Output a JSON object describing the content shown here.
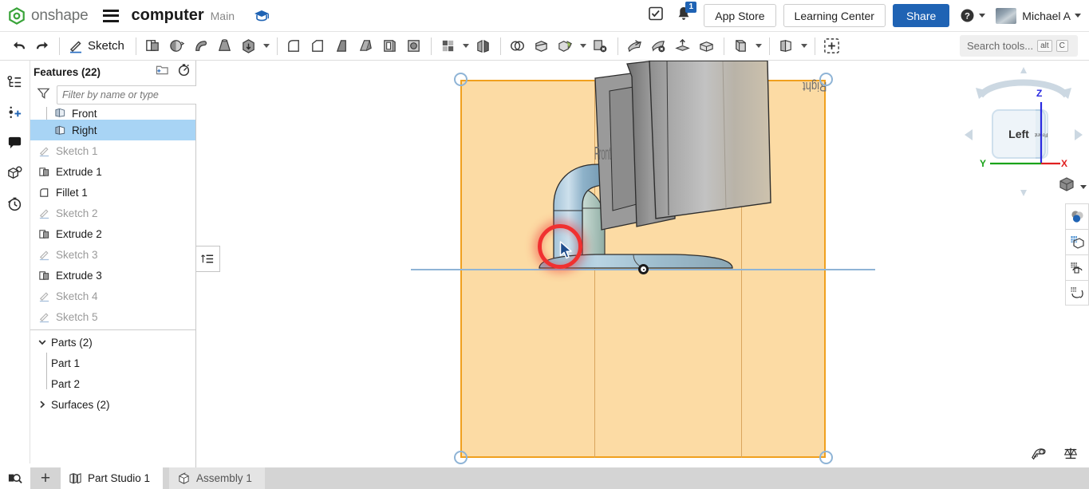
{
  "topbar": {
    "brand": "onshape",
    "document_title": "computer",
    "branch": "Main",
    "notification_count": "1",
    "app_store_label": "App Store",
    "learning_center_label": "Learning Center",
    "share_label": "Share",
    "user_name": "Michael A",
    "icons": {
      "hamburger": "hamburger-menu-icon",
      "grad_cap": "graduation-cap-icon",
      "checklist": "checklist-icon",
      "bell": "notification-bell-icon",
      "help": "help-question-icon"
    }
  },
  "toolbar": {
    "sketch_label": "Sketch",
    "search_placeholder": "Search tools...",
    "kbd_alt": "alt",
    "kbd_key": "C",
    "tools": [
      "undo-icon",
      "redo-icon",
      "sketch-icon",
      "extrude-icon",
      "revolve-icon",
      "sweep-icon",
      "loft-icon",
      "thicken-icon",
      "fillet-icon",
      "chamfer-icon",
      "draft-icon",
      "rib-icon",
      "shell-icon",
      "hole-icon",
      "plane-icon",
      "mirror-icon",
      "boolean-icon",
      "split-icon",
      "transform-icon",
      "delete-face-icon",
      "move-face-icon",
      "delete-part-icon",
      "import-icon",
      "enclose-icon",
      "curve-icon",
      "surface-icon",
      "variable-icon"
    ]
  },
  "left_rail": {
    "items": [
      {
        "name": "feature-list-icon"
      },
      {
        "name": "add-version-icon"
      },
      {
        "name": "comments-icon"
      },
      {
        "name": "part-info-icon"
      },
      {
        "name": "history-icon"
      }
    ]
  },
  "feature_panel": {
    "title": "Features (22)",
    "filter_placeholder": "Filter by name or type",
    "head_icons": [
      "new-folder-icon",
      "rollback-timer-icon"
    ],
    "tree": [
      {
        "label": "Front",
        "type": "plane",
        "state": "clipped",
        "indent": 1
      },
      {
        "label": "Right",
        "type": "plane",
        "state": "selected",
        "indent": 1
      },
      {
        "label": "Sketch 1",
        "type": "sketch",
        "state": "dim",
        "indent": 0
      },
      {
        "label": "Extrude 1",
        "type": "extrude",
        "state": "normal",
        "indent": 0
      },
      {
        "label": "Fillet 1",
        "type": "fillet",
        "state": "normal",
        "indent": 0
      },
      {
        "label": "Sketch 2",
        "type": "sketch",
        "state": "dim",
        "indent": 0
      },
      {
        "label": "Extrude 2",
        "type": "extrude",
        "state": "normal",
        "indent": 0
      },
      {
        "label": "Sketch 3",
        "type": "sketch",
        "state": "dim",
        "indent": 0
      },
      {
        "label": "Extrude 3",
        "type": "extrude",
        "state": "normal",
        "indent": 0
      },
      {
        "label": "Sketch 4",
        "type": "sketch",
        "state": "dim",
        "indent": 0
      },
      {
        "label": "Sketch 5",
        "type": "sketch",
        "state": "dim",
        "indent": 0
      }
    ],
    "parts_group": {
      "label": "Parts (2)",
      "expanded": true,
      "items": [
        "Part 1",
        "Part 2"
      ]
    },
    "surfaces_group": {
      "label": "Surfaces (2)",
      "expanded": false
    },
    "collapse_tab_icon": "panel-collapse-icon"
  },
  "viewport": {
    "plane_labels": {
      "front": "Front",
      "right": "Right"
    },
    "plane_color": "#f0a01e",
    "plane_fill": "#fabe5a",
    "handle_color": "#8fb4d6",
    "cursor_highlight_color": "#f03030",
    "viewcube": {
      "face_label": "Left",
      "side_label": "Front",
      "axis_x": "X",
      "axis_y": "Y",
      "axis_z": "Z",
      "axis_x_color": "#e02020",
      "axis_y_color": "#1aa31a",
      "axis_z_color": "#2a2ae0",
      "perspective_icon": "view-perspective-cube-icon"
    },
    "display_tools": [
      "shaded-view-icon",
      "section-view-icon",
      "rotate-view-icon",
      "explode-view-icon"
    ],
    "bottom_tools": [
      "measure-tape-icon",
      "mass-properties-icon"
    ]
  },
  "bottom": {
    "search_icon": "search-tabs-icon",
    "add_tab_label": "+",
    "tabs": [
      {
        "label": "Part Studio 1",
        "icon": "part-studio-icon",
        "active": true
      },
      {
        "label": "Assembly 1",
        "icon": "assembly-icon",
        "active": false
      }
    ]
  }
}
